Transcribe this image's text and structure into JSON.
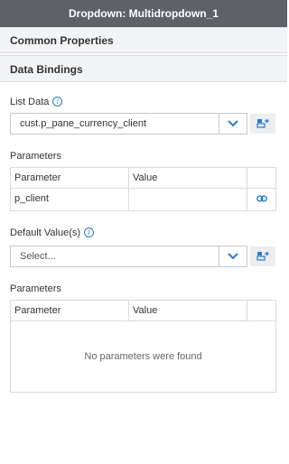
{
  "window": {
    "title": "Dropdown: Multidropdown_1"
  },
  "sections": {
    "common": "Common Properties",
    "bindings": "Data Bindings"
  },
  "list_data": {
    "label": "List Data",
    "value": "cust.p_pane_currency_client"
  },
  "parameters1": {
    "label": "Parameters",
    "columns": [
      "Parameter",
      "Value"
    ],
    "rows": [
      {
        "parameter": "p_client",
        "value": ""
      }
    ]
  },
  "default_values": {
    "label": "Default Value(s)",
    "placeholder": "Select..."
  },
  "parameters2": {
    "label": "Parameters",
    "columns": [
      "Parameter",
      "Value"
    ],
    "empty_message": "No parameters were found"
  },
  "colors": {
    "titlebar": "#5e6166",
    "accent": "#2b7bbf",
    "section_bg": "#f3f4f6"
  },
  "icons": [
    "info-icon",
    "chevron-down-icon",
    "data-source-icon",
    "link-icon"
  ]
}
